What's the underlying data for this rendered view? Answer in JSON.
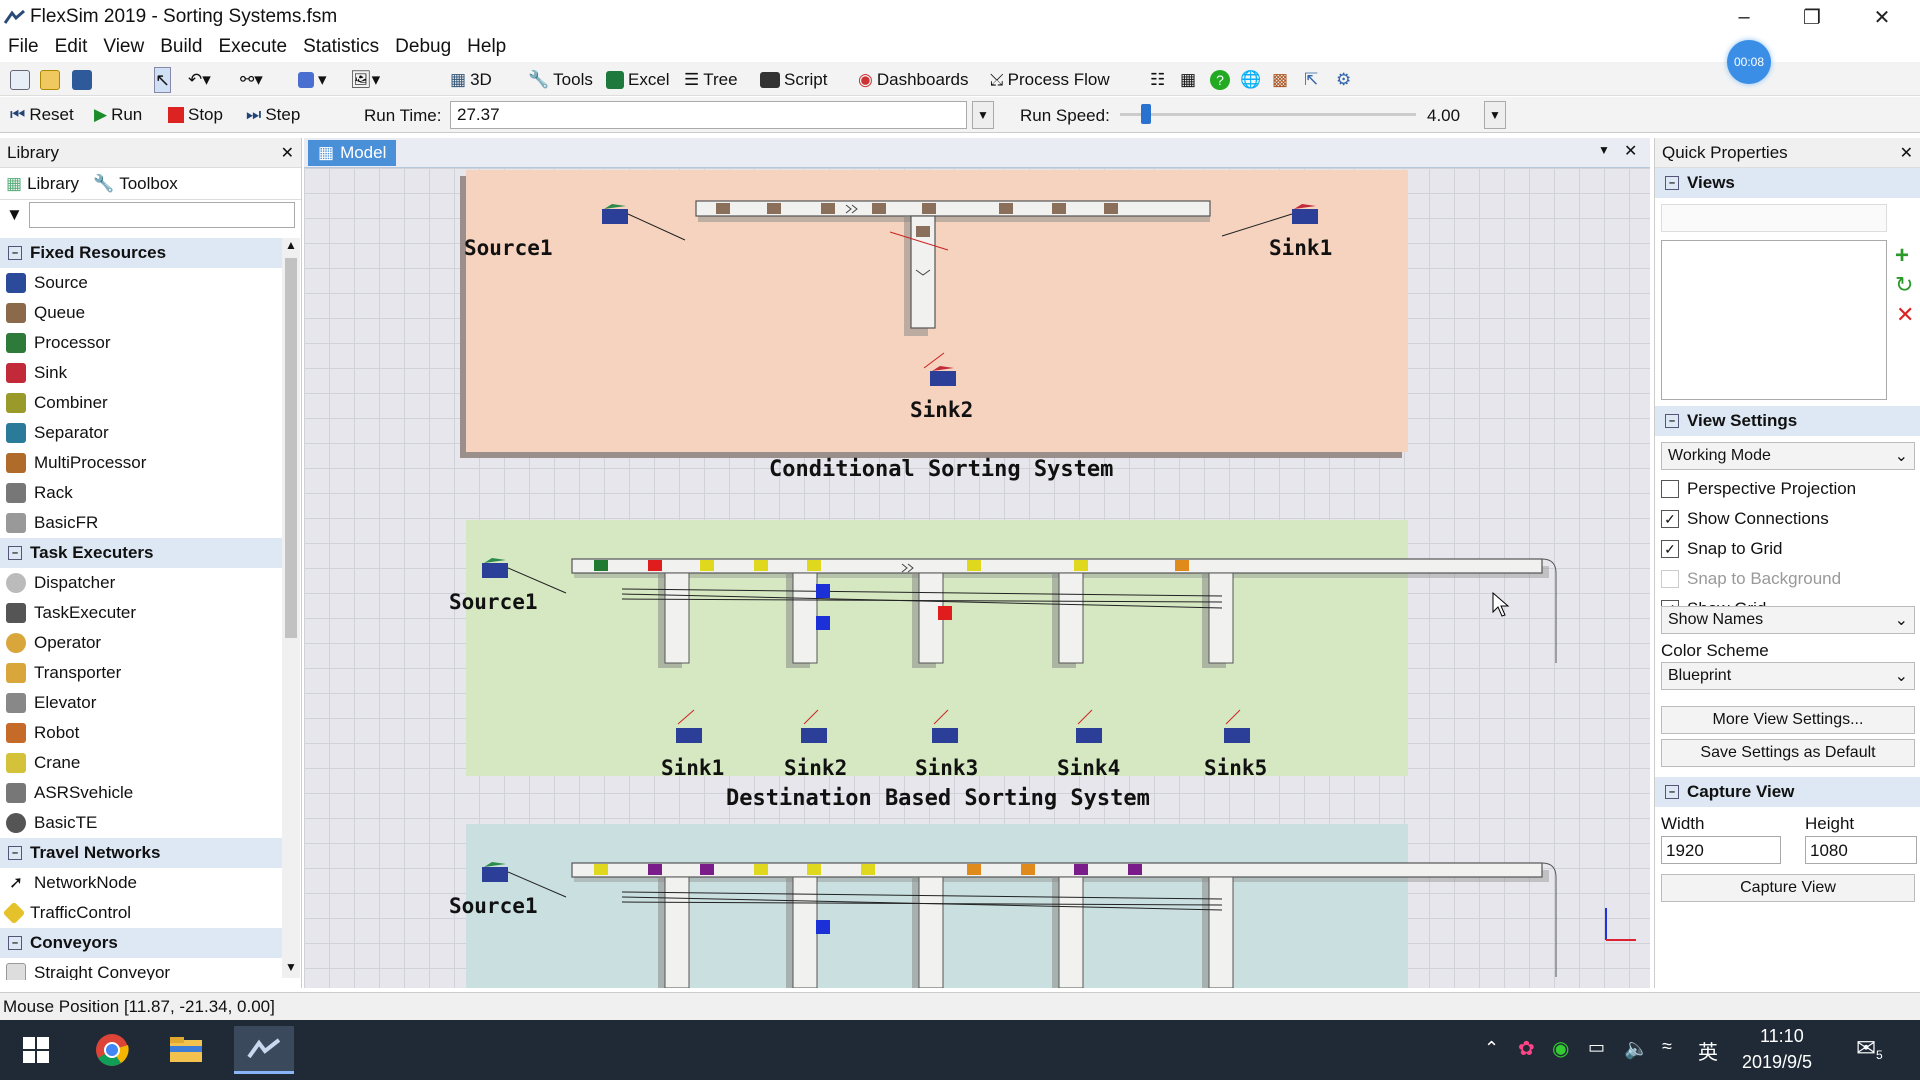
{
  "window": {
    "title": "FlexSim 2019 - Sorting Systems.fsm",
    "timer_badge": "00:08"
  },
  "menu": [
    "File",
    "Edit",
    "View",
    "Build",
    "Execute",
    "Statistics",
    "Debug",
    "Help"
  ],
  "toolbar": {
    "btn_3d": "3D",
    "tools": "Tools",
    "excel": "Excel",
    "tree": "Tree",
    "script": "Script",
    "dashboards": "Dashboards",
    "process_flow": "Process Flow"
  },
  "runbar": {
    "reset": "Reset",
    "run": "Run",
    "stop": "Stop",
    "step": "Step",
    "run_time_label": "Run Time:",
    "run_time_value": "27.37",
    "run_speed_label": "Run Speed:",
    "run_speed_value": "4.00"
  },
  "library": {
    "header": "Library",
    "tabs": [
      "Library",
      "Toolbox"
    ],
    "filter_placeholder": "",
    "categories": [
      {
        "name": "Fixed Resources",
        "items": [
          "Source",
          "Queue",
          "Processor",
          "Sink",
          "Combiner",
          "Separator",
          "MultiProcessor",
          "Rack",
          "BasicFR"
        ]
      },
      {
        "name": "Task Executers",
        "items": [
          "Dispatcher",
          "TaskExecuter",
          "Operator",
          "Transporter",
          "Elevator",
          "Robot",
          "Crane",
          "ASRSvehicle",
          "BasicTE"
        ]
      },
      {
        "name": "Travel Networks",
        "items": [
          "NetworkNode",
          "TrafficControl"
        ]
      },
      {
        "name": "Conveyors",
        "items": [
          "Straight Conveyor"
        ]
      }
    ]
  },
  "model": {
    "tab": "Model",
    "systems": [
      {
        "name": "Conditional Sorting System",
        "source": "Source1",
        "sinks": [
          "Sink1",
          "Sink2"
        ],
        "color": "#f5d3bf"
      },
      {
        "name": "Destination Based Sorting System",
        "source": "Source1",
        "sinks": [
          "Sink1",
          "Sink2",
          "Sink3",
          "Sink4",
          "Sink5"
        ],
        "color": "#d6e8c2"
      },
      {
        "name": "",
        "source": "Source1",
        "sinks": [],
        "color": "#c9dfe0"
      }
    ]
  },
  "quick": {
    "header": "Quick Properties",
    "views_section": "Views",
    "view_settings_section": "View Settings",
    "view_mode": "Working Mode",
    "checks": [
      {
        "label": "Perspective Projection",
        "checked": false,
        "enabled": true
      },
      {
        "label": "Show Connections",
        "checked": true,
        "enabled": true
      },
      {
        "label": "Snap to Grid",
        "checked": true,
        "enabled": true
      },
      {
        "label": "Snap to Background",
        "checked": false,
        "enabled": false
      },
      {
        "label": "Show Grid",
        "checked": true,
        "enabled": true
      }
    ],
    "show_names": "Show Names",
    "color_scheme_label": "Color Scheme",
    "color_scheme": "Blueprint",
    "more_view_settings": "More View Settings...",
    "save_default": "Save Settings as Default",
    "capture_section": "Capture View",
    "width_label": "Width",
    "height_label": "Height",
    "width_value": "1920",
    "height_value": "1080",
    "capture_button": "Capture View"
  },
  "status": {
    "mouse_position": "Mouse Position [11.87, -21.34, 0.00]"
  },
  "taskbar": {
    "time": "11:10",
    "date": "2019/9/5",
    "ime": "英",
    "notifications": "5"
  }
}
